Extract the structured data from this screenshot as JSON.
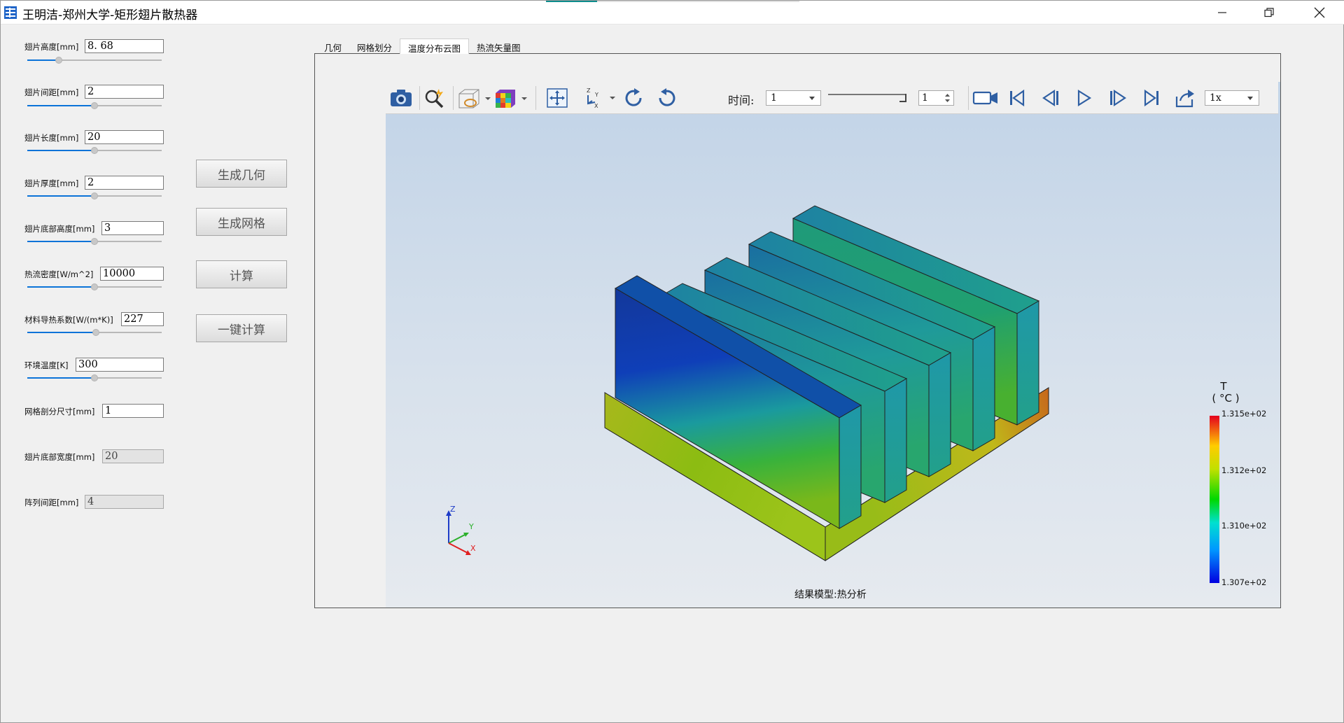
{
  "window": {
    "title": "王明洁-郑州大学-矩形翅片散热器",
    "controls": [
      "minimize",
      "restore",
      "close"
    ]
  },
  "params": [
    {
      "label": "翅片高度[mm]",
      "value": "8. 68",
      "slider": 0.3,
      "readonly": false
    },
    {
      "label": "翅片间距[mm]",
      "value": "2",
      "slider": 0.5,
      "readonly": false
    },
    {
      "label": "翅片长度[mm]",
      "value": "20",
      "slider": 0.5,
      "readonly": false
    },
    {
      "label": "翅片厚度[mm]",
      "value": "2",
      "slider": 0.5,
      "readonly": false
    },
    {
      "label": "翅片底部高度[mm]",
      "value": "3",
      "slider": 0.5,
      "readonly": false
    },
    {
      "label": "热流密度[W/m^2]",
      "value": "10000",
      "slider": 0.5,
      "readonly": false
    },
    {
      "label": "材料导热系数[W/(m*K)]",
      "value": "227",
      "slider": 0.51,
      "readonly": false
    },
    {
      "label": "环境温度[K]",
      "value": "300",
      "slider": 0.5,
      "readonly": false
    },
    {
      "label": "网格剖分尺寸[mm]",
      "value": "1",
      "slider": null,
      "readonly": false
    },
    {
      "label": "翅片底部宽度[mm]",
      "value": "20",
      "slider": null,
      "readonly": true
    },
    {
      "label": "阵列间距[mm]",
      "value": "4",
      "slider": null,
      "readonly": true
    }
  ],
  "buttons": {
    "generate_geometry": "生成几何",
    "generate_mesh": "生成网格",
    "compute": "计算",
    "one_click_compute": "一键计算"
  },
  "tabs": [
    {
      "label": "几何",
      "active": false
    },
    {
      "label": "网格划分",
      "active": false
    },
    {
      "label": "温度分布云图",
      "active": true
    },
    {
      "label": "热流矢量图",
      "active": false
    }
  ],
  "toolbar": {
    "time_label": "时间:",
    "time_value": "1",
    "step_value": "1",
    "speed_value": "1x",
    "icons": [
      "camera-icon",
      "zoom-icon",
      "view-cube-icon",
      "color-cube-icon",
      "fit-view-icon",
      "axes-icon",
      "rotate-cw-icon",
      "rotate-ccw-icon",
      "record-icon",
      "first-frame-icon",
      "prev-frame-icon",
      "play-icon",
      "next-frame-icon",
      "last-frame-icon",
      "export-icon"
    ]
  },
  "viewer": {
    "caption": "结果模型:热分析",
    "legend_title_line1": "T",
    "legend_title_line2": "( °C )",
    "legend_ticks": [
      "1.315e+02",
      "1.312e+02",
      "1.310e+02",
      "1.307e+02"
    ],
    "axis_labels": {
      "z": "Z",
      "y": "Y",
      "x": "X"
    }
  }
}
